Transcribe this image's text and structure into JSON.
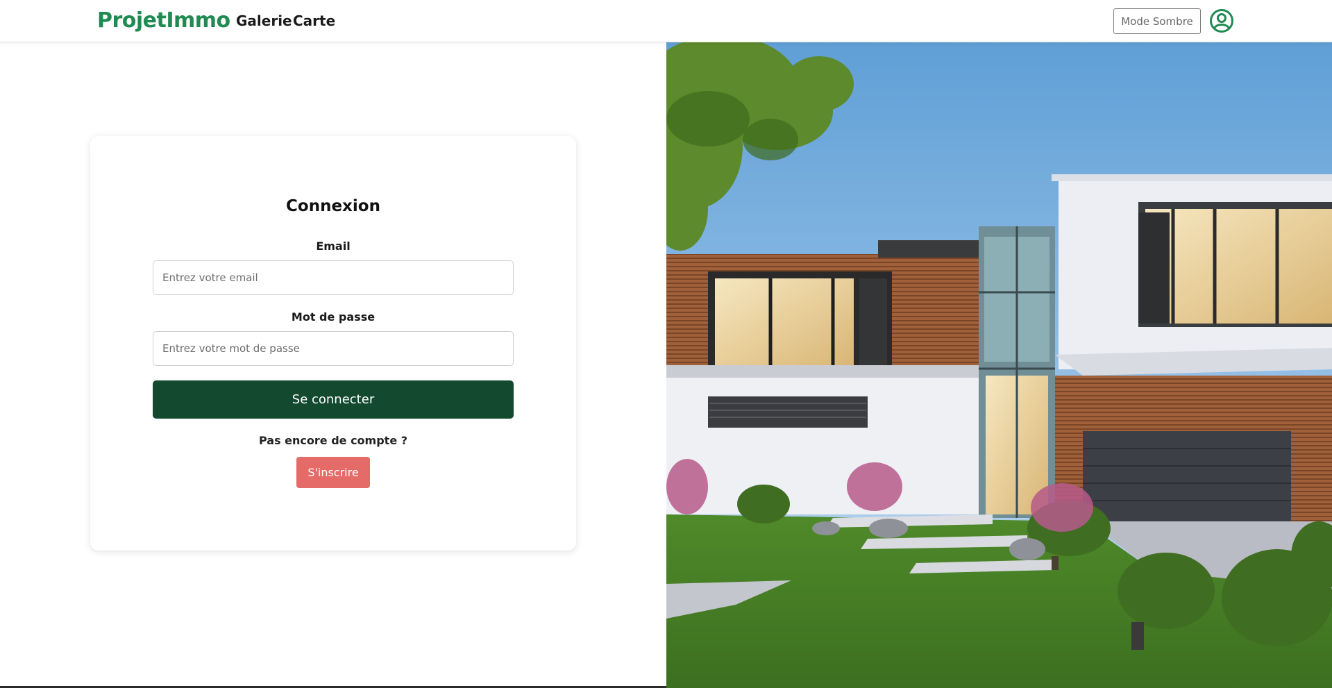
{
  "navbar": {
    "brand": "ProjetImmo",
    "links": [
      "Galerie",
      "Carte"
    ],
    "mode_button": "Mode Sombre",
    "account_icon": "user-circle-icon"
  },
  "login": {
    "title": "Connexion",
    "email_label": "Email",
    "email_placeholder": "Entrez votre email",
    "password_label": "Mot de passe",
    "password_placeholder": "Entrez votre mot de passe",
    "submit_label": "Se connecter",
    "no_account_text": "Pas encore de compte ?",
    "signup_label": "S'inscrire"
  },
  "colors": {
    "brand": "#1f8a52",
    "submit_button": "#134a2f",
    "signup_button": "#e56b69"
  },
  "hero_image": "modern-house-photo"
}
